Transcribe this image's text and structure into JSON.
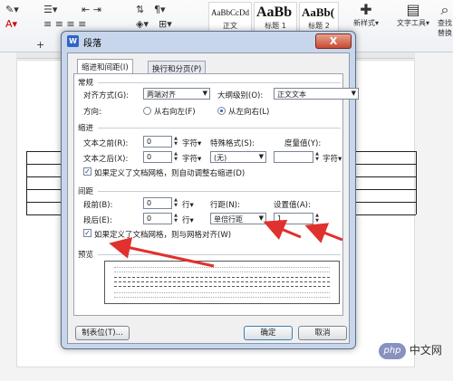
{
  "ribbon": {
    "styles": [
      {
        "sample": "AaBbCcDd",
        "label": "正文"
      },
      {
        "sample": "AaBb",
        "label": "标题 1"
      },
      {
        "sample": "AaBb(",
        "label": "标题 2"
      }
    ],
    "new_style_label": "新样式",
    "text_tools_label": "文字工具",
    "find_replace_label": "查找替换"
  },
  "dialog": {
    "title": "段落",
    "close_label": "X",
    "tabs": [
      {
        "label": "缩进和间距(I)"
      },
      {
        "label": "换行和分页(P)"
      }
    ],
    "general": {
      "section_label": "常规",
      "alignment_label": "对齐方式(G):",
      "alignment_value": "两端对齐",
      "outline_label": "大纲级别(O):",
      "outline_value": "正文文本",
      "direction_label": "方向:",
      "rtl_label": "从右向左(F)",
      "ltr_label": "从左向右(L)"
    },
    "indent": {
      "section_label": "缩进",
      "before_label": "文本之前(R):",
      "before_value": "0",
      "before_unit": "字符▾",
      "after_label": "文本之后(X):",
      "after_value": "0",
      "after_unit": "字符▾",
      "special_label": "特殊格式(S):",
      "special_value": "(无)",
      "measure_label": "度量值(Y):",
      "measure_unit": "字符▾",
      "grid_check_label": "如果定义了文档网格，则自动调整右缩进(D)"
    },
    "spacing": {
      "section_label": "间距",
      "before_label": "段前(B):",
      "before_value": "0",
      "before_unit": "行▾",
      "after_label": "段后(E):",
      "after_value": "0",
      "after_unit": "行▾",
      "line_label": "行距(N):",
      "line_value": "单倍行距",
      "setting_label": "设置值(A):",
      "setting_value": "1",
      "grid_check_label": "如果定义了文档网格，则与网格对齐(W)"
    },
    "preview_label": "预览",
    "tabs_button": "制表位(T)...",
    "ok_button": "确定",
    "cancel_button": "取消"
  },
  "watermark": {
    "logo": "php",
    "text": "中文网"
  },
  "colors": {
    "accent": "#2b5fc2",
    "annotation": "#e0312e"
  }
}
